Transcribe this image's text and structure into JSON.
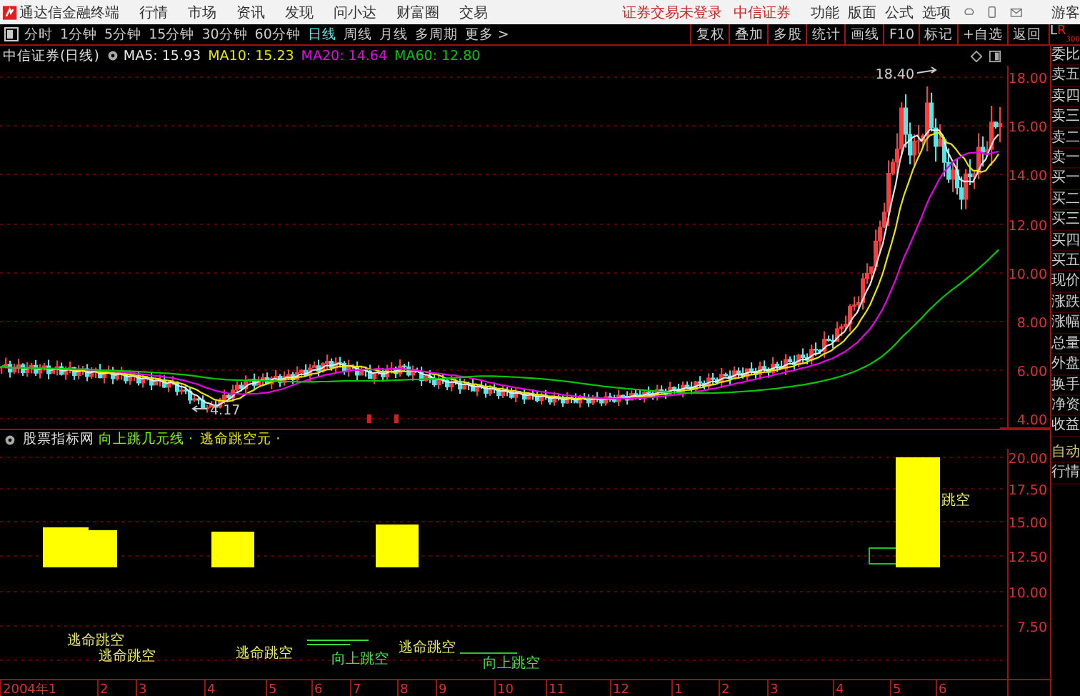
{
  "menu_bar": {
    "app_name": "通达信金融终端",
    "menus": [
      "行情",
      "市场",
      "资讯",
      "发现",
      "问小达",
      "财富圈",
      "交易"
    ],
    "login_status": "证券交易未登录",
    "broker": "中信证券",
    "tools": [
      "功能",
      "版面",
      "公式",
      "选项"
    ],
    "user": "游客"
  },
  "period_bar": {
    "periods": [
      {
        "label": "分时",
        "selected": false
      },
      {
        "label": "1分钟",
        "selected": false
      },
      {
        "label": "5分钟",
        "selected": false
      },
      {
        "label": "15分钟",
        "selected": false
      },
      {
        "label": "30分钟",
        "selected": false
      },
      {
        "label": "60分钟",
        "selected": false
      },
      {
        "label": "日线",
        "selected": true
      },
      {
        "label": "周线",
        "selected": false
      },
      {
        "label": "月线",
        "selected": false
      },
      {
        "label": "多周期",
        "selected": false
      },
      {
        "label": "更多 >",
        "selected": false
      }
    ],
    "actions": [
      "复权",
      "叠加",
      "多股",
      "统计",
      "画线",
      "F10",
      "标记",
      "+自选",
      "返回"
    ],
    "panel_toggle": {
      "left": "L",
      "right": "R",
      "count": "300"
    }
  },
  "price_chart": {
    "title": "中信证券(日线)",
    "ma": [
      {
        "label": "MA5: 15.93",
        "color": "#e8e8e8"
      },
      {
        "label": "MA10: 15.23",
        "color": "#e8e800"
      },
      {
        "label": "MA20: 14.64",
        "color": "#e800e8"
      },
      {
        "label": "MA60: 12.80",
        "color": "#00c800"
      }
    ],
    "yticks": [
      "18.00",
      "16.00",
      "14.00",
      "12.00",
      "10.00",
      "8.00",
      "6.00",
      "4.00"
    ],
    "high_label": "18.40",
    "low_label": "4.17"
  },
  "indicator": {
    "name": "股票指标网",
    "lines": [
      {
        "label": "向上跳几元线 ·",
        "color": "#7cfc00"
      },
      {
        "label": "逃命跳空元 ·",
        "color": "#e8e800"
      }
    ],
    "yticks": [
      "20.00",
      "17.50",
      "15.00",
      "12.50",
      "10.00",
      "7.50"
    ],
    "labels": [
      {
        "text": "逃命跳空",
        "kind": "escape"
      },
      {
        "text": "逃命跳空",
        "kind": "escape"
      },
      {
        "text": "逃命跳空",
        "kind": "escape"
      },
      {
        "text": "向上跳空",
        "kind": "up"
      },
      {
        "text": "逃命跳空",
        "kind": "escape"
      },
      {
        "text": "向上跳空",
        "kind": "up"
      },
      {
        "text": "跳空",
        "kind": "escape"
      }
    ]
  },
  "x_axis": [
    "2004年1",
    "2",
    "3",
    "4",
    "5",
    "6",
    "7",
    "8",
    "9",
    "10",
    "11",
    "12",
    "1",
    "2",
    "3",
    "4",
    "5",
    "6"
  ],
  "quote_panel": {
    "fields": [
      "委比",
      "卖五",
      "卖四",
      "卖三",
      "卖二",
      "卖一",
      "买一",
      "买二",
      "买三",
      "买四",
      "买五",
      "现价",
      "涨跌",
      "涨幅",
      "总量",
      "外盘",
      "换手",
      "净资",
      "收益"
    ],
    "buttons": [
      "自动",
      "行情"
    ]
  }
}
